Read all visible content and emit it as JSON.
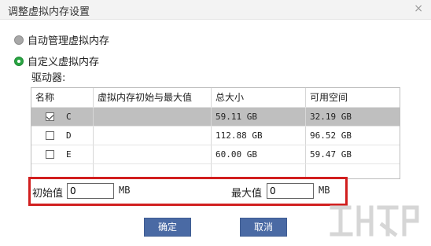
{
  "window": {
    "title": "调整虚拟内存设置",
    "close": "×"
  },
  "options": {
    "auto": {
      "label": "自动管理虚拟内存",
      "selected": false
    },
    "custom": {
      "label": "自定义虚拟内存",
      "selected": true
    }
  },
  "drives_label": "驱动器:",
  "table": {
    "headers": [
      "名称",
      "虚拟内存初始与最大值",
      "总大小",
      "可用空间"
    ],
    "rows": [
      {
        "checked": true,
        "name": "C",
        "range": "",
        "total": "59.11 GB",
        "free": "32.19 GB",
        "selected": true
      },
      {
        "checked": false,
        "name": "D",
        "range": "",
        "total": "112.88 GB",
        "free": "96.52 GB",
        "selected": false
      },
      {
        "checked": false,
        "name": "E",
        "range": "",
        "total": "60.00 GB",
        "free": "59.47 GB",
        "selected": false
      }
    ]
  },
  "initial": {
    "label": "初始值",
    "value": "0",
    "unit": "MB"
  },
  "maximum": {
    "label": "最大值",
    "value": "0",
    "unit": "MB"
  },
  "buttons": {
    "ok": "确定",
    "cancel": "取消"
  },
  "colors": {
    "accent_button": "#4a6aa4",
    "highlight_border": "#d11f1f",
    "radio_selected": "#2aa543",
    "row_selected": "#bfbfbf"
  }
}
